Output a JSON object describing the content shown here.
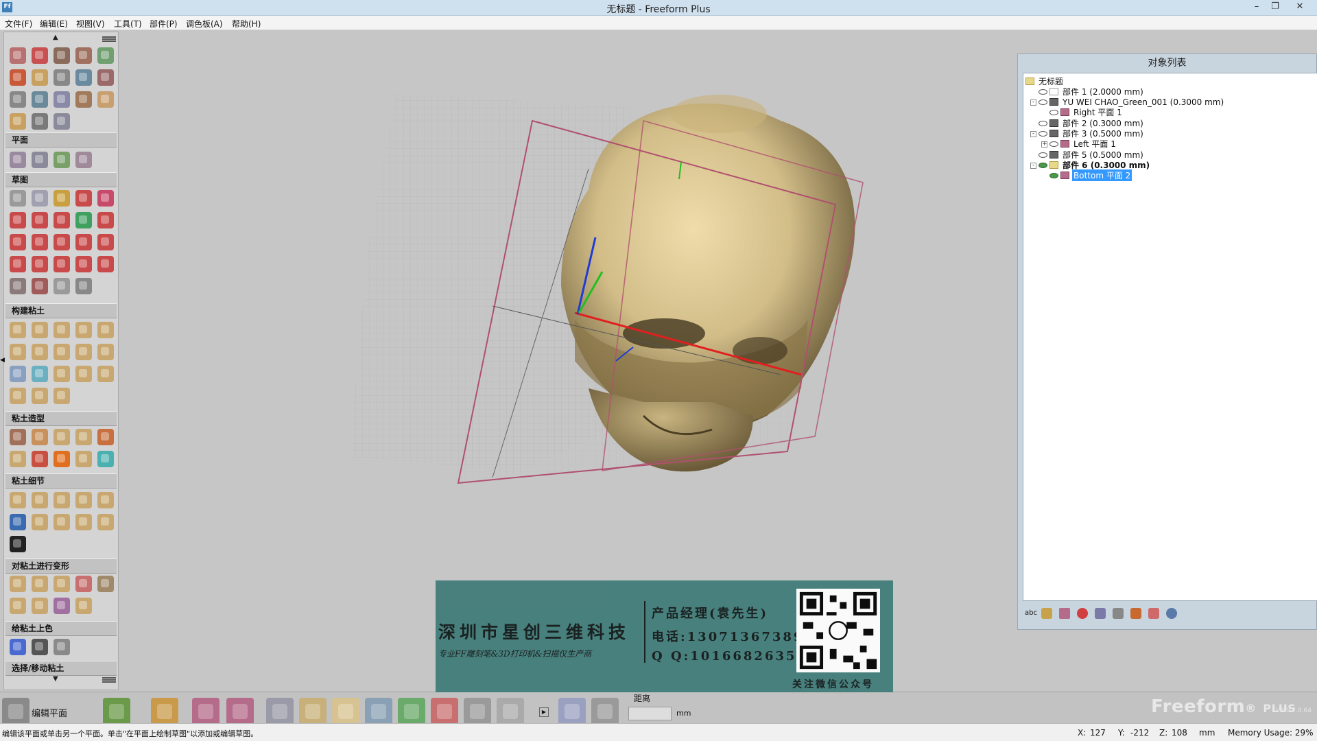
{
  "window": {
    "title": "无标题 - Freeform Plus",
    "app_icon": "Ff",
    "minimize_glyph": "–",
    "restore_glyph": "❐",
    "close_glyph": "✕"
  },
  "menu": {
    "file": "文件(F)",
    "edit": "编辑(E)",
    "view": "视图(V)",
    "tools": "工具(T)",
    "part": "部件(P)",
    "palette": "调色板(A)",
    "help": "帮助(H)"
  },
  "left_panel": {
    "scroll_up": "▲",
    "scroll_down": "▼",
    "expander": "◀",
    "sections": {
      "plane": "平面",
      "sketch": "草图",
      "build_clay": "构建粘土",
      "clay_sculpt": "粘土造型",
      "clay_detail": "粘土细节",
      "deform_clay": "对粘土进行变形",
      "color_clay": "给粘土上色",
      "select_move": "选择/移动粘土"
    }
  },
  "object_list": {
    "title": "对象列表",
    "root": "无标题",
    "items": [
      {
        "label": "部件 1 (2.0000 mm)"
      },
      {
        "label": "YU WEI CHAO_Green_001 (0.3000 mm)"
      },
      {
        "label": "Right 平面 1"
      },
      {
        "label": "部件 2 (0.3000 mm)"
      },
      {
        "label": "部件 3 (0.5000 mm)"
      },
      {
        "label": "Left 平面 1"
      },
      {
        "label": "部件 5 (0.5000 mm)"
      },
      {
        "label": "部件 6 (0.3000 mm)"
      },
      {
        "label": "Bottom 平面 2"
      }
    ],
    "toolbar_text": "abc"
  },
  "bottom_toolbar": {
    "edit_plane": "编辑平面",
    "distance_label": "距离",
    "distance_value": "",
    "unit": "mm",
    "play_glyph": "▶",
    "brand": "Freeform",
    "brand_reg": "®",
    "brand_plus": "PLUS",
    "version": "V2017.0.64"
  },
  "status": {
    "message": "编辑该平面或单击另一个平面。单击\"在平面上绘制草图\"以添加或编辑草图。",
    "x_label": "X:",
    "x": "127",
    "y_label": "Y:",
    "y": "-212",
    "z_label": "Z:",
    "z": "108",
    "unit": "mm",
    "memory": "Memory Usage: 29%"
  },
  "watermark": {
    "company": "深圳市星创三维科技",
    "slogan": "专业FF雕刻笔&3D打印机&扫描仪生产商",
    "manager": "产品经理(袁先生)",
    "phone": "电话:13071367389",
    "qq": "Q Q:1016682635",
    "follow": "关注微信公众号"
  },
  "colors": {
    "titlebar": "#cfe0ef",
    "panel": "#d4d4d4",
    "viewport": "#c6c6c6",
    "skull": "#d7c391",
    "plane_outline": "#b0506e",
    "selection": "#3399ff",
    "watermark": "#3f7b78"
  }
}
